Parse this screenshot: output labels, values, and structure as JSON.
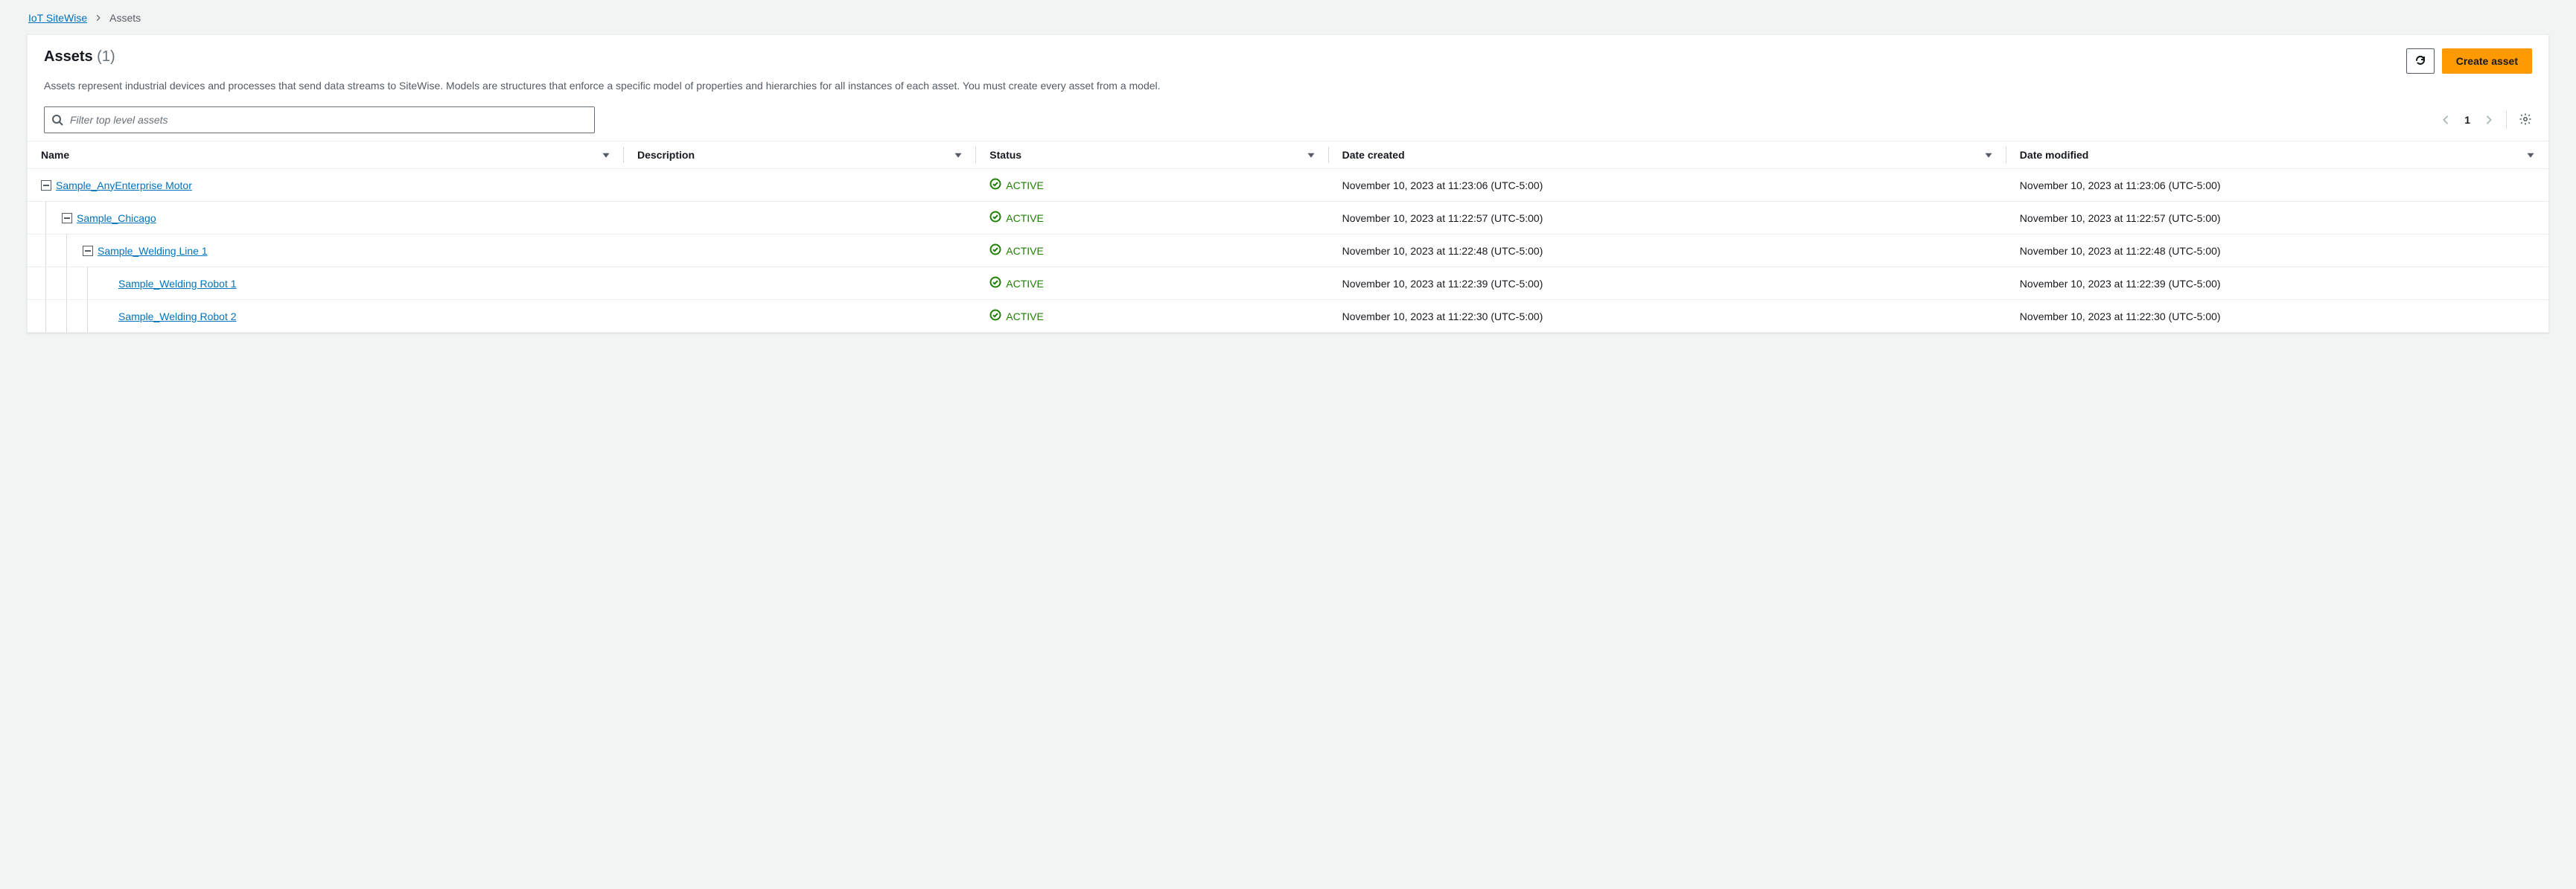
{
  "breadcrumb": {
    "root": "IoT SiteWise",
    "current": "Assets"
  },
  "header": {
    "title": "Assets",
    "count": "(1)",
    "description": "Assets represent industrial devices and processes that send data streams to SiteWise. Models are structures that enforce a specific model of properties and hierarchies for all instances of each asset. You must create every asset from a model.",
    "refresh_label": "Refresh",
    "create_label": "Create asset"
  },
  "search": {
    "placeholder": "Filter top level assets"
  },
  "pagination": {
    "current": "1"
  },
  "columns": {
    "name": "Name",
    "description": "Description",
    "status": "Status",
    "date_created": "Date created",
    "date_modified": "Date modified"
  },
  "status_label": "ACTIVE",
  "rows": [
    {
      "indent": 0,
      "expandable": true,
      "name": "Sample_AnyEnterprise Motor",
      "description": "",
      "status": "ACTIVE",
      "date_created": "November 10, 2023 at 11:23:06 (UTC-5:00)",
      "date_modified": "November 10, 2023 at 11:23:06 (UTC-5:00)"
    },
    {
      "indent": 1,
      "expandable": true,
      "name": "Sample_Chicago",
      "description": "",
      "status": "ACTIVE",
      "date_created": "November 10, 2023 at 11:22:57 (UTC-5:00)",
      "date_modified": "November 10, 2023 at 11:22:57 (UTC-5:00)"
    },
    {
      "indent": 2,
      "expandable": true,
      "name": "Sample_Welding Line 1",
      "description": "",
      "status": "ACTIVE",
      "date_created": "November 10, 2023 at 11:22:48 (UTC-5:00)",
      "date_modified": "November 10, 2023 at 11:22:48 (UTC-5:00)"
    },
    {
      "indent": 3,
      "expandable": false,
      "name": "Sample_Welding Robot 1",
      "description": "",
      "status": "ACTIVE",
      "date_created": "November 10, 2023 at 11:22:39 (UTC-5:00)",
      "date_modified": "November 10, 2023 at 11:22:39 (UTC-5:00)"
    },
    {
      "indent": 3,
      "expandable": false,
      "name": "Sample_Welding Robot 2",
      "description": "",
      "status": "ACTIVE",
      "date_created": "November 10, 2023 at 11:22:30 (UTC-5:00)",
      "date_modified": "November 10, 2023 at 11:22:30 (UTC-5:00)"
    }
  ]
}
